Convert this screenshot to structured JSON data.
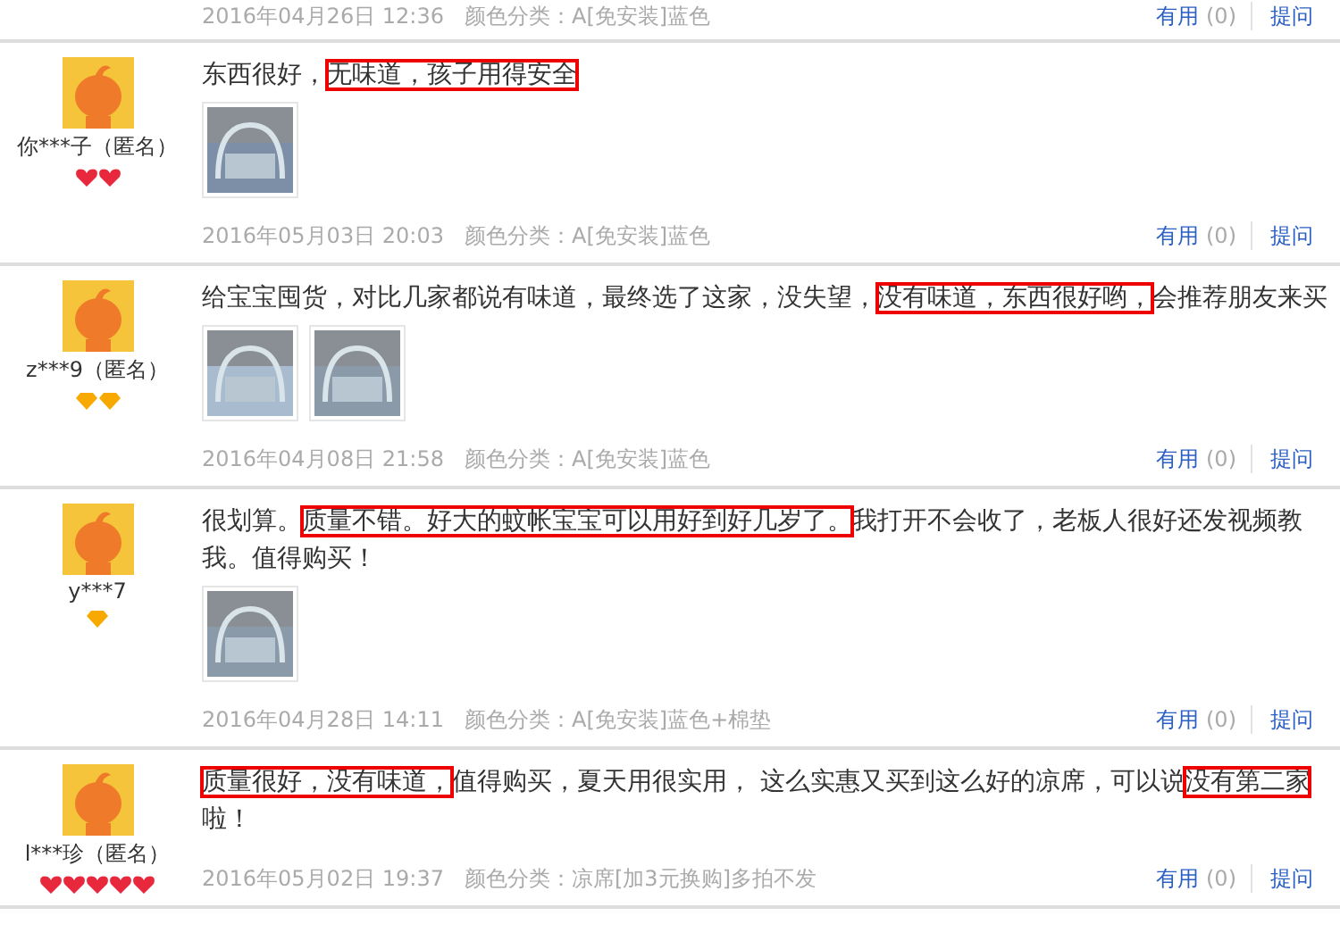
{
  "previous_footer": {
    "date": "2016年04月26日 12:36",
    "spec": "颜色分类：A[免安装]蓝色",
    "useful": "有用",
    "useful_count": "(0)",
    "ask": "提问"
  },
  "reviews": [
    {
      "user": "你***子（匿名）",
      "badges": [
        {
          "kind": "heart"
        },
        {
          "kind": "heart"
        }
      ],
      "text": [
        {
          "t": "东西很好，",
          "highlight": false
        },
        {
          "t": "无味道，孩子用得安全",
          "highlight": true
        }
      ],
      "photos": [
        {
          "kind": "picture"
        }
      ],
      "date": "2016年05月03日 20:03",
      "spec": "颜色分类：A[免安装]蓝色",
      "useful": "有用",
      "useful_count": "(0)",
      "ask": "提问"
    },
    {
      "user": "z***9（匿名）",
      "badges": [
        {
          "kind": "diamond"
        },
        {
          "kind": "diamond"
        }
      ],
      "text": [
        {
          "t": "给宝宝囤货，对比几家都说有味道，最终选了这家，没失望，",
          "highlight": false
        },
        {
          "t": "没有味道，东西很好哟，",
          "highlight": true
        },
        {
          "t": "会推荐朋友来买",
          "highlight": false
        }
      ],
      "photos": [
        {
          "kind": "picture"
        },
        {
          "kind": "picture"
        }
      ],
      "date": "2016年04月08日 21:58",
      "spec": "颜色分类：A[免安装]蓝色",
      "useful": "有用",
      "useful_count": "(0)",
      "ask": "提问"
    },
    {
      "user": "y***7",
      "badges": [
        {
          "kind": "diamond"
        }
      ],
      "text": [
        {
          "t": "很划算。",
          "highlight": false
        },
        {
          "t": "质量不错。好大的蚊帐宝宝可以用好到好几岁了。",
          "highlight": true
        },
        {
          "t": "我打开不会收了，老板人很好还发视频教我。值得购买！",
          "highlight": false
        }
      ],
      "photos": [
        {
          "kind": "picture"
        }
      ],
      "date": "2016年04月28日 14:11",
      "spec": "颜色分类：A[免安装]蓝色+棉垫",
      "useful": "有用",
      "useful_count": "(0)",
      "ask": "提问"
    },
    {
      "user": "l***珍（匿名）",
      "badges": [
        {
          "kind": "heart"
        },
        {
          "kind": "heart"
        },
        {
          "kind": "heart"
        },
        {
          "kind": "heart"
        },
        {
          "kind": "heart"
        }
      ],
      "text": [
        {
          "t": "质量很好，没有味道，",
          "highlight": true
        },
        {
          "t": "值得购买，夏天用很实用， 这么实惠又买到这么好的凉席，可以说",
          "highlight": false
        },
        {
          "t": "没有第二家",
          "highlight": true
        },
        {
          "t": "啦！",
          "highlight": false
        }
      ],
      "date": "2016年05月02日 19:37",
      "spec": "颜色分类：凉席[加3元换购]多拍不发",
      "useful": "有用",
      "useful_count": "(0)",
      "ask": "提问"
    }
  ]
}
